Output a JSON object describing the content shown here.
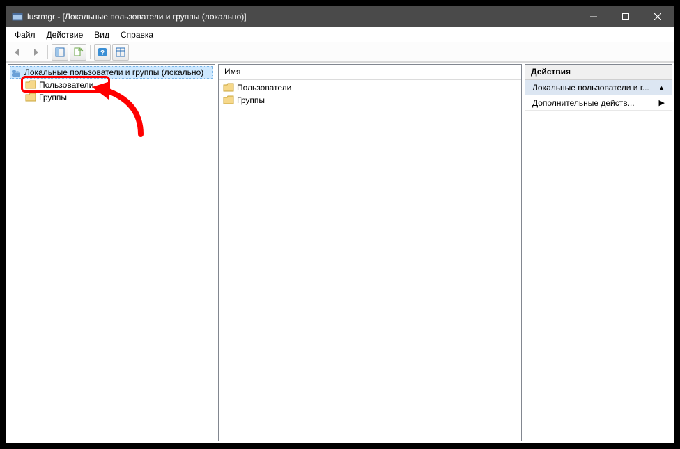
{
  "titlebar": {
    "title": "lusrmgr - [Локальные пользователи и группы (локально)]"
  },
  "menubar": {
    "file": "Файл",
    "action": "Действие",
    "view": "Вид",
    "help": "Справка"
  },
  "tree": {
    "root": "Локальные пользователи и группы (локально)",
    "users": "Пользователи",
    "groups": "Группы"
  },
  "list": {
    "header_name": "Имя",
    "items": [
      {
        "label": "Пользователи"
      },
      {
        "label": "Группы"
      }
    ]
  },
  "actions": {
    "header": "Действия",
    "section": "Локальные пользователи и г...",
    "more": "Дополнительные действ..."
  }
}
